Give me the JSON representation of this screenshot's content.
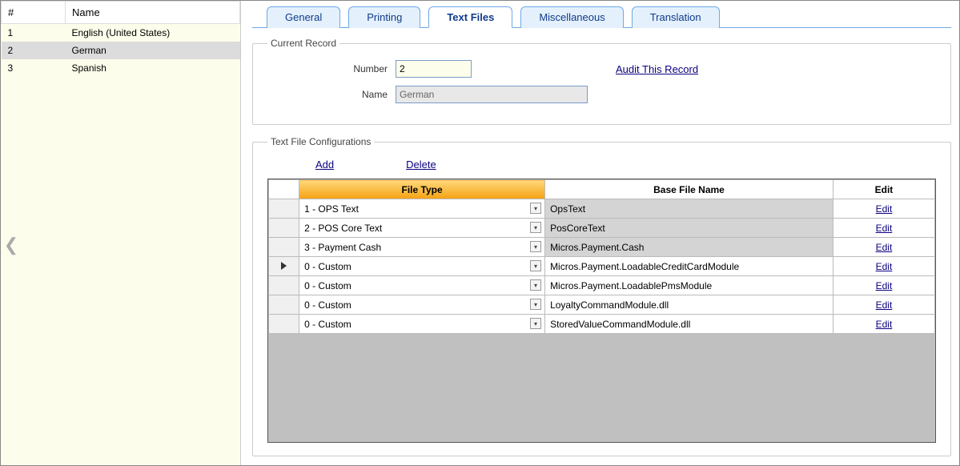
{
  "left_panel": {
    "columns": {
      "num": "#",
      "name": "Name"
    },
    "rows": [
      {
        "num": "1",
        "name": "English (United States)",
        "selected": false
      },
      {
        "num": "2",
        "name": "German",
        "selected": true
      },
      {
        "num": "3",
        "name": "Spanish",
        "selected": false
      }
    ]
  },
  "tabs": [
    {
      "label": "General",
      "active": false
    },
    {
      "label": "Printing",
      "active": false
    },
    {
      "label": "Text Files",
      "active": true
    },
    {
      "label": "Miscellaneous",
      "active": false
    },
    {
      "label": "Translation",
      "active": false
    }
  ],
  "current_record": {
    "legend": "Current Record",
    "number_label": "Number",
    "number_value": "2",
    "name_label": "Name",
    "name_value": "German",
    "audit_link": "Audit This Record"
  },
  "text_file_cfg": {
    "legend": "Text File Configurations",
    "add_label": "Add",
    "delete_label": "Delete",
    "headers": {
      "file_type": "File Type",
      "base_file": "Base File Name",
      "edit": "Edit"
    },
    "edit_label": "Edit",
    "rows": [
      {
        "marker": false,
        "file_type": "1 - OPS Text",
        "base_file": "OpsText",
        "base_locked": true
      },
      {
        "marker": false,
        "file_type": "2 - POS Core Text",
        "base_file": "PosCoreText",
        "base_locked": true
      },
      {
        "marker": false,
        "file_type": "3 - Payment Cash",
        "base_file": "Micros.Payment.Cash",
        "base_locked": true
      },
      {
        "marker": true,
        "file_type": "0 - Custom",
        "base_file": "Micros.Payment.LoadableCreditCardModule",
        "base_locked": false
      },
      {
        "marker": false,
        "file_type": "0 - Custom",
        "base_file": "Micros.Payment.LoadablePmsModule",
        "base_locked": false
      },
      {
        "marker": false,
        "file_type": "0 - Custom",
        "base_file": "LoyaltyCommandModule.dll",
        "base_locked": false
      },
      {
        "marker": false,
        "file_type": "0 - Custom",
        "base_file": "StoredValueCommandModule.dll",
        "base_locked": false
      }
    ]
  }
}
